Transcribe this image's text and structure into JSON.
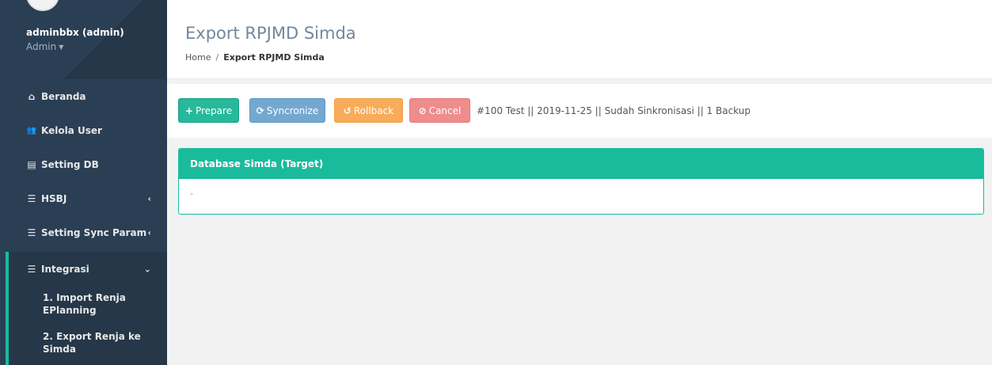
{
  "user": {
    "name": "adminbbx (admin)",
    "role": "Admin"
  },
  "sidebar": {
    "items": [
      {
        "label": "Beranda",
        "icon": "home-icon",
        "glyph": "⌂"
      },
      {
        "label": "Kelola User",
        "icon": "users-icon",
        "glyph": "👥"
      },
      {
        "label": "Setting DB",
        "icon": "database-icon",
        "glyph": "▤"
      },
      {
        "label": "HSBJ",
        "icon": "list-icon",
        "glyph": "☰"
      },
      {
        "label": "Setting Sync Param",
        "icon": "list-icon",
        "glyph": "☰"
      },
      {
        "label": "Integrasi",
        "icon": "list-icon",
        "glyph": "☰"
      }
    ],
    "submenu": [
      {
        "label": "1. Import Renja EPlanning"
      },
      {
        "label": "2. Export Renja ke Simda"
      }
    ]
  },
  "header": {
    "title": "Export RPJMD Simda",
    "breadcrumb": {
      "home": "Home",
      "separator": "/",
      "current": "Export RPJMD Simda"
    }
  },
  "toolbar": {
    "prepare_label": "Prepare",
    "sync_label": "Syncronize",
    "rollback_label": "Rollback",
    "cancel_label": "Cancel",
    "status_text": "#100 Test || 2019-11-25 || Sudah Sinkronisasi || 1 Backup"
  },
  "panel": {
    "title": "Database Simda (Target)",
    "body": "-"
  },
  "colors": {
    "sidebar_bg": "#2a3f54",
    "accent": "#1abb9c",
    "prepare": "#26b99a",
    "sync": "#74a8d0",
    "rollback": "#f8ac59",
    "cancel": "#ef8c8c"
  }
}
